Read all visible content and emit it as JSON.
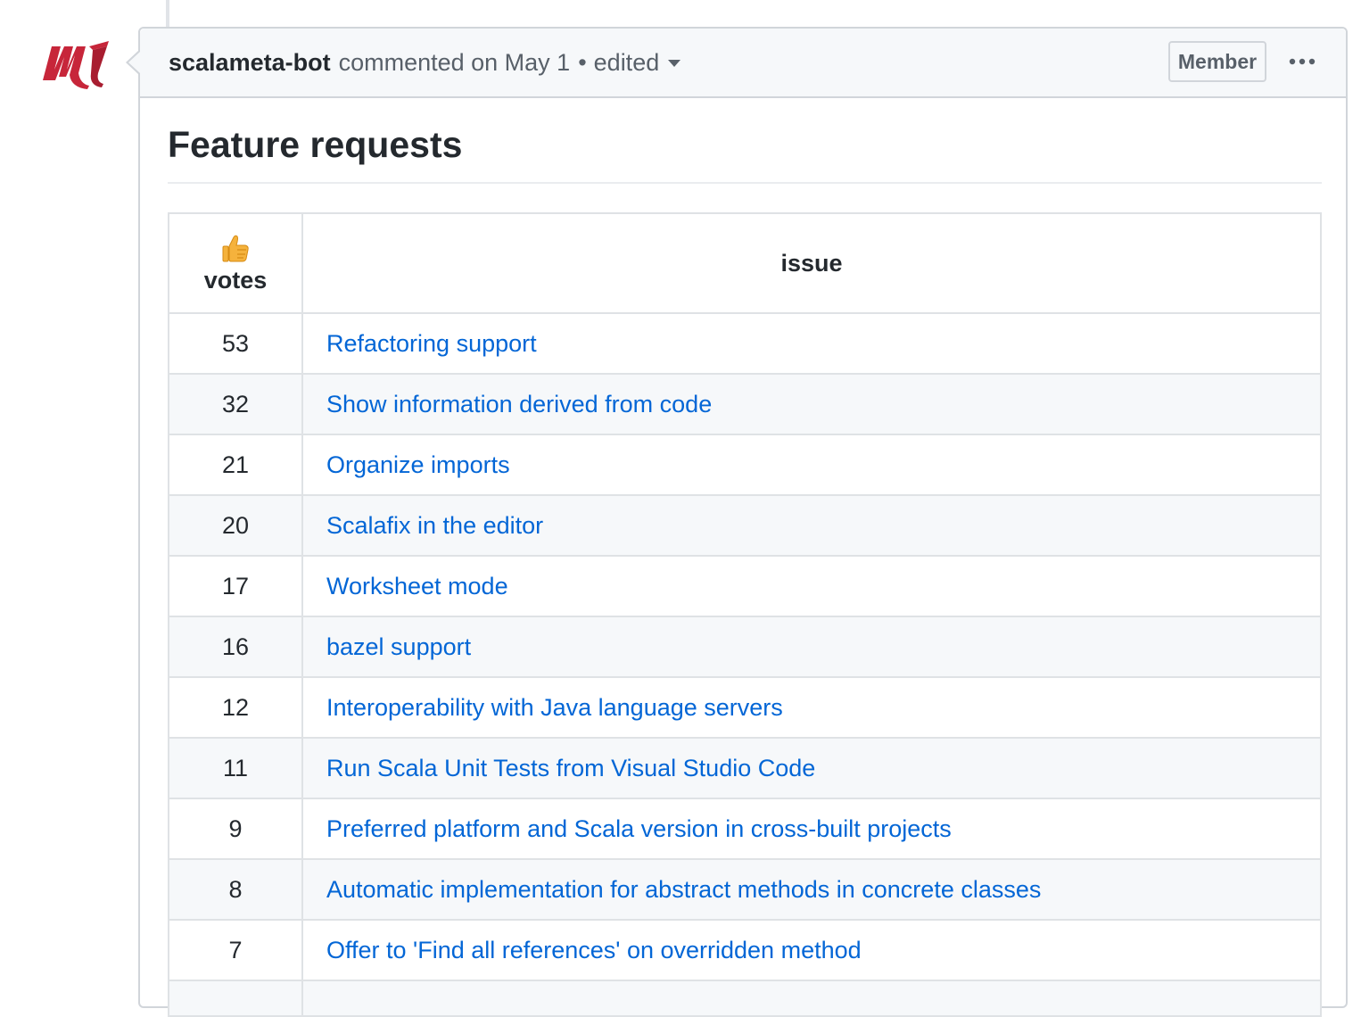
{
  "comment": {
    "author": "scalameta-bot",
    "action": "commented on May 1",
    "separator": "•",
    "edited_label": "edited",
    "badge": "Member",
    "avatar_icon": "scalameta-logo-icon",
    "more_icon": "kebab-horizontal-icon"
  },
  "body": {
    "heading": "Feature requests",
    "table": {
      "headers": {
        "votes_icon": "thumbs-up-icon",
        "votes": "votes",
        "issue": "issue"
      },
      "rows": [
        {
          "votes": "53",
          "issue": "Refactoring support"
        },
        {
          "votes": "32",
          "issue": "Show information derived from code"
        },
        {
          "votes": "21",
          "issue": "Organize imports"
        },
        {
          "votes": "20",
          "issue": "Scalafix in the editor"
        },
        {
          "votes": "17",
          "issue": "Worksheet mode"
        },
        {
          "votes": "16",
          "issue": "bazel support"
        },
        {
          "votes": "12",
          "issue": "Interoperability with Java language servers"
        },
        {
          "votes": "11",
          "issue": "Run Scala Unit Tests from Visual Studio Code"
        },
        {
          "votes": "9",
          "issue": "Preferred platform and Scala version in cross-built projects"
        },
        {
          "votes": "8",
          "issue": "Automatic implementation for abstract methods in concrete classes"
        },
        {
          "votes": "7",
          "issue": "Offer to 'Find all references' on overridden method"
        }
      ]
    }
  },
  "colors": {
    "link": "#0366d6",
    "border": "#d1d5da",
    "header_bg": "#f6f8fa",
    "logo": "#c7263a"
  }
}
